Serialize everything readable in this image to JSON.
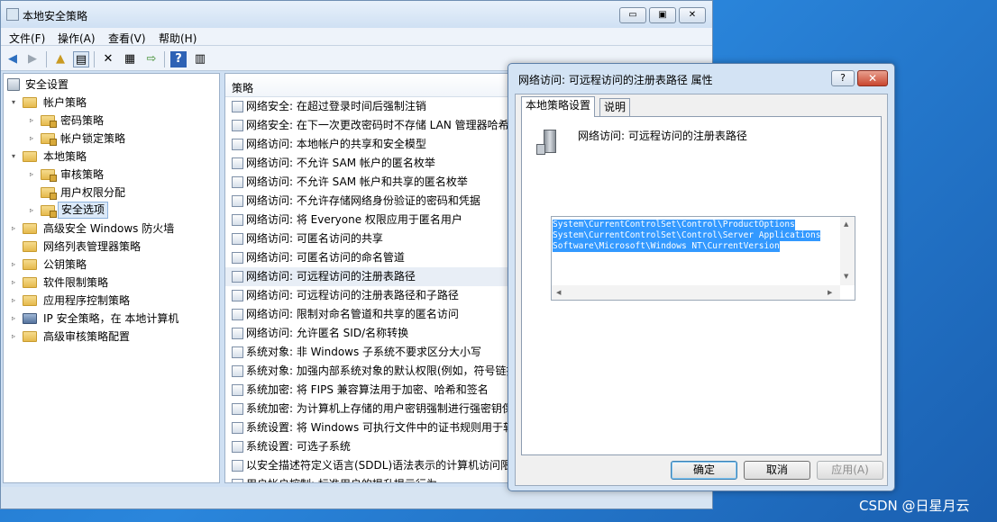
{
  "main_window": {
    "title": "本地安全策略",
    "caption_buttons": {
      "minimize": "▭",
      "maximize": "▣",
      "close": "✕"
    },
    "menu": [
      "文件(F)",
      "操作(A)",
      "查看(V)",
      "帮助(H)"
    ],
    "toolbar_icons": [
      "back-arrow-icon",
      "forward-arrow-icon",
      "up-folder-icon",
      "show-tree-icon",
      "delete-icon",
      "properties-icon",
      "export-icon",
      "help-icon",
      "view-icon"
    ]
  },
  "tree": {
    "root": "安全设置",
    "items": [
      {
        "label": "帐户策略",
        "arrow": "▾"
      },
      {
        "label": "密码策略",
        "arrow": "▹"
      },
      {
        "label": "帐户锁定策略",
        "arrow": "▹"
      },
      {
        "label": "本地策略",
        "arrow": "▾"
      },
      {
        "label": "审核策略",
        "arrow": "▹"
      },
      {
        "label": "用户权限分配",
        "arrow": ""
      },
      {
        "label": "安全选项",
        "arrow": "▹"
      },
      {
        "label": "高级安全 Windows 防火墙",
        "arrow": "▹"
      },
      {
        "label": "网络列表管理器策略",
        "arrow": ""
      },
      {
        "label": "公钥策略",
        "arrow": "▹"
      },
      {
        "label": "软件限制策略",
        "arrow": "▹"
      },
      {
        "label": "应用程序控制策略",
        "arrow": "▹"
      },
      {
        "label": "IP 安全策略，在 本地计算机",
        "arrow": "▹"
      },
      {
        "label": "高级审核策略配置",
        "arrow": "▹"
      }
    ]
  },
  "list": {
    "header": "策略",
    "rows": [
      "网络安全: 在超过登录时间后强制注销",
      "网络安全: 在下一次更改密码时不存储 LAN 管理器哈希",
      "网络访问: 本地帐户的共享和安全模型",
      "网络访问: 不允许 SAM 帐户的匿名枚举",
      "网络访问: 不允许 SAM 帐户和共享的匿名枚举",
      "网络访问: 不允许存储网络身份验证的密码和凭据",
      "网络访问: 将 Everyone 权限应用于匿名用户",
      "网络访问: 可匿名访问的共享",
      "网络访问: 可匿名访问的命名管道",
      "网络访问: 可远程访问的注册表路径",
      "网络访问: 可远程访问的注册表路径和子路径",
      "网络访问: 限制对命名管道和共享的匿名访问",
      "网络访问: 允许匿名 SID/名称转换",
      "系统对象: 非 Windows 子系统不要求区分大小写",
      "系统对象: 加强内部系统对象的默认权限(例如，符号链接",
      "系统加密: 将 FIPS 兼容算法用于加密、哈希和签名",
      "系统加密: 为计算机上存储的用户密钥强制进行强密钥保",
      "系统设置: 将 Windows 可执行文件中的证书规则用于软",
      "系统设置: 可选子系统",
      "以安全描述符定义语言(SDDL)语法表示的计算机访问限",
      "用户帐户控制: 标准用户的提升提示行为"
    ]
  },
  "dialog": {
    "title": "网络访问: 可远程访问的注册表路径 属性",
    "help_label": "?",
    "close_label": "✕",
    "tabs": [
      "本地策略设置",
      "说明"
    ],
    "heading": "网络访问: 可远程访问的注册表路径",
    "paths": [
      "System\\CurrentControlSet\\Control\\ProductOptions",
      "System\\CurrentControlSet\\Control\\Server Applications",
      "Software\\Microsoft\\Windows NT\\CurrentVersion"
    ],
    "buttons": {
      "ok": "确定",
      "cancel": "取消",
      "apply": "应用(A)"
    }
  },
  "watermark": "CSDN @日星月云"
}
